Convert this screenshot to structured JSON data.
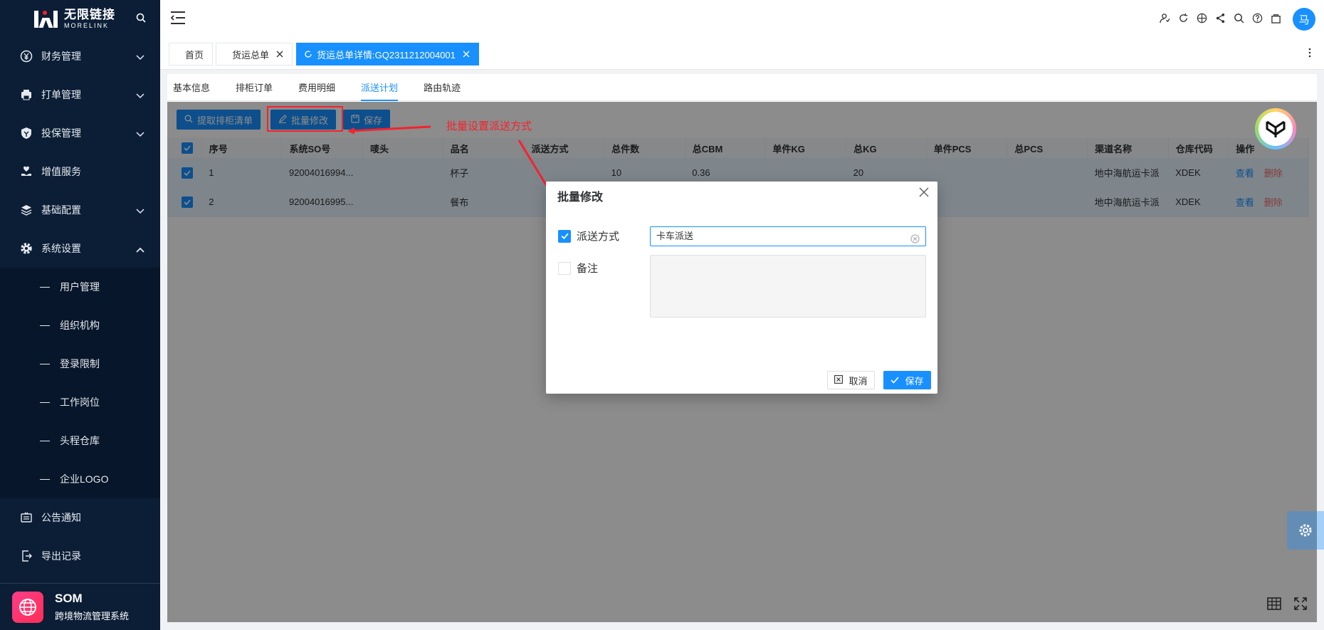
{
  "brand": {
    "name_cn": "无限链接",
    "name_en": "MORELINK",
    "product": "SOM",
    "product_sub": "跨境物流管理系统"
  },
  "sidebar": {
    "items": [
      {
        "label": "财务管理",
        "icon": "yen-icon",
        "expandable": true
      },
      {
        "label": "打单管理",
        "icon": "printer-icon",
        "expandable": true
      },
      {
        "label": "投保管理",
        "icon": "shield-icon",
        "expandable": true
      },
      {
        "label": "增值服务",
        "icon": "heart-hand-icon",
        "expandable": false
      },
      {
        "label": "基础配置",
        "icon": "layers-icon",
        "expandable": true
      },
      {
        "label": "系统设置",
        "icon": "gear-icon",
        "expandable": true,
        "expanded": true
      }
    ],
    "subitems": [
      "用户管理",
      "组织机构",
      "登录限制",
      "工作岗位",
      "头程仓库",
      "企业LOGO"
    ],
    "bottom_items": [
      {
        "label": "公告通知",
        "icon": "notice-icon"
      },
      {
        "label": "导出记录",
        "icon": "export-icon"
      }
    ]
  },
  "header": {
    "avatar_text": "马"
  },
  "page_tabs": [
    {
      "label": "首页",
      "closable": false,
      "active": false
    },
    {
      "label": "货运总单",
      "closable": true,
      "active": false
    },
    {
      "label": "货运总单详情:GQ2311212004001",
      "closable": true,
      "active": true
    }
  ],
  "sub_tabs": [
    "基本信息",
    "排柜订单",
    "费用明细",
    "派送计划",
    "路由轨迹"
  ],
  "sub_tab_active": "派送计划",
  "toolbar": {
    "extract_label": "提取排柜清单",
    "batch_edit_label": "批量修改",
    "save_label": "保存"
  },
  "table": {
    "columns": [
      "序号",
      "系统SO号",
      "唛头",
      "品名",
      "派送方式",
      "总件数",
      "总CBM",
      "单件KG",
      "总KG",
      "单件PCS",
      "总PCS",
      "渠道名称",
      "仓库代码",
      "操作"
    ],
    "rows": [
      {
        "seq": "1",
        "so": "92004016994...",
        "mark": "",
        "name": "杯子",
        "method": "",
        "pieces": "10",
        "cbm": "0.36",
        "unit_kg": "",
        "kg": "20",
        "unit_pcs": "",
        "pcs": "",
        "channel": "地中海航运卡派",
        "warehouse": "XDEK"
      },
      {
        "seq": "2",
        "so": "92004016995...",
        "mark": "",
        "name": "餐布",
        "method": "",
        "pieces": "",
        "cbm": "",
        "unit_kg": "",
        "kg": "",
        "unit_pcs": "",
        "pcs": "",
        "channel": "地中海航运卡派",
        "warehouse": "XDEK"
      }
    ],
    "action_view": "查看",
    "action_delete": "删除"
  },
  "annotation": {
    "text": "批量设置派送方式"
  },
  "dialog": {
    "title": "批量修改",
    "field1_label": "派送方式",
    "field1_checked": true,
    "field1_value": "卡车派送",
    "field2_label": "备注",
    "field2_checked": false,
    "field2_value": "",
    "cancel_label": "取消",
    "save_label": "保存"
  },
  "colors": {
    "sidebar_bg": "#0b1e36",
    "primary": "#1890ff",
    "danger": "#f56c6c",
    "annotation": "#f5222d"
  }
}
